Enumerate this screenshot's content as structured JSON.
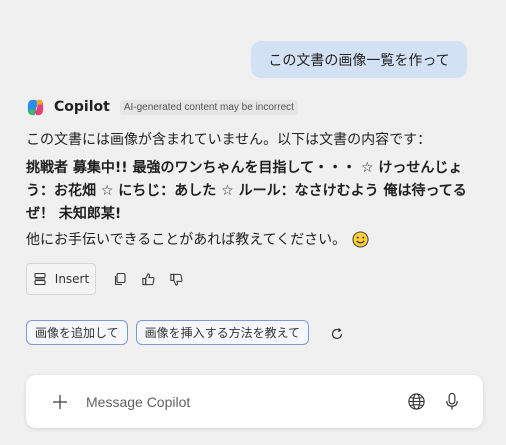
{
  "user_message": "この文書の画像一覧を作って",
  "assistant": {
    "name": "Copilot",
    "disclaimer": "AI-generated content may be incorrect",
    "intro": "この文書には画像が含まれていません。以下は文書の内容です：",
    "content": "挑戦者 募集中!! 最強のワンちゃんを目指して・・・ ☆ けっせんじょう：お花畑 ☆ にちじ：あした ☆ ルール：なさけむよう 俺は待ってるぜ！ 未知郎某!",
    "closing": "他にお手伝いできることがあれば教えてください。"
  },
  "actions": {
    "insert_label": "Insert",
    "icons": [
      "insert-icon",
      "copy-icon",
      "thumbs-up-icon",
      "thumbs-down-icon"
    ]
  },
  "suggestions": [
    "画像を追加して",
    "画像を挿入する方法を教えて"
  ],
  "composer": {
    "placeholder": "Message Copilot",
    "icons": [
      "plus-icon",
      "globe-icon",
      "microphone-icon"
    ]
  },
  "colors": {
    "background": "#f0f0f0",
    "user_bubble": "#d3e1f5",
    "chip_border": "#7d9ad4"
  }
}
